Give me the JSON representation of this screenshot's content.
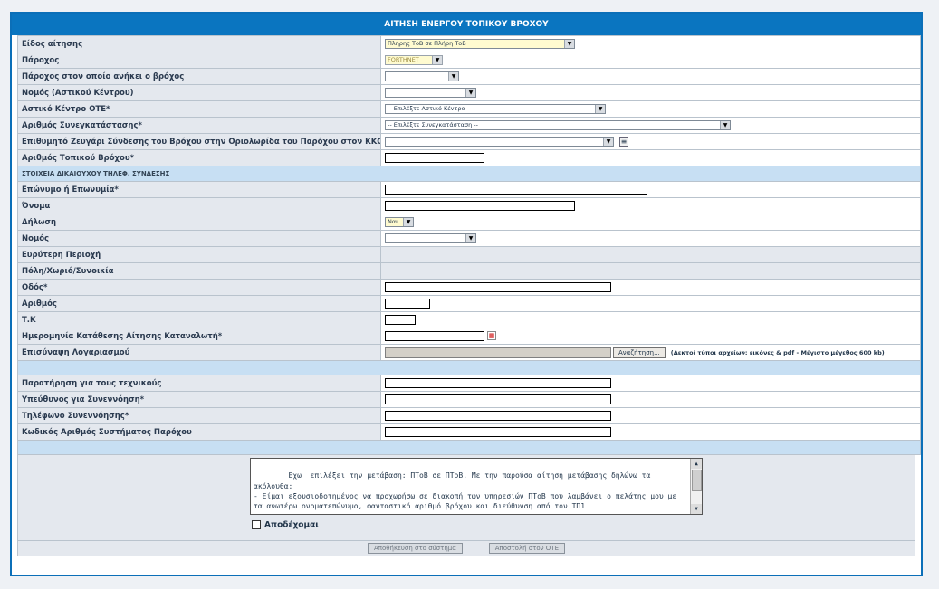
{
  "title": "ΑΙΤΗΣΗ ΕΝΕΡΓΟΥ ΤΟΠΙΚΟΥ ΒΡΟΧΟΥ",
  "fields": {
    "request_type": {
      "label": "Είδος αίτησης",
      "value": "Πλήρης ΤοΒ σε Πλήρη ΤοΒ"
    },
    "provider": {
      "label": "Πάροχος",
      "value": "FORTHNET"
    },
    "loop_provider": {
      "label": "Πάροχος στον οποίο ανήκει ο βρόχος",
      "value": ""
    },
    "prefecture_center": {
      "label": "Νομός (Αστικού Κέντρου)",
      "value": ""
    },
    "ote_center": {
      "label": "Αστικό Κέντρο ΟΤΕ*",
      "value": "-- Επιλέξτε Αστικό Κέντρο --"
    },
    "colocation": {
      "label": "Αριθμός Συνεγκατάστασης*",
      "value": "-- Επιλέξτε Συνεγκατάσταση --"
    },
    "pair": {
      "label": "Επιθυμητό Ζευγάρι Σύνδεσης του Βρόχου στην Οριολωρίδα του Παρόχου στον ΚΚΟ *",
      "value": ""
    },
    "loop_number": {
      "label": "Αριθμός Τοπικού Βρόχου*",
      "value": ""
    }
  },
  "section_subscriber": "ΣΤΟΙΧΕΙΑ ΔΙΚΑΙΟΥΧΟΥ ΤΗΛΕΦ. ΣΥΝΔΕΣΗΣ",
  "subscriber": {
    "surname": {
      "label": "Επώνυμο ή Επωνυμία*",
      "value": ""
    },
    "name": {
      "label": "Όνομα",
      "value": ""
    },
    "declaration": {
      "label": "Δήλωση",
      "value": "Ναι"
    },
    "prefecture": {
      "label": "Νομός",
      "value": ""
    },
    "wider_area": {
      "label": "Ευρύτερη Περιοχή"
    },
    "city": {
      "label": "Πόλη/Χωριό/Συνοικία"
    },
    "street": {
      "label": "Οδός*",
      "value": ""
    },
    "number": {
      "label": "Αριθμός",
      "value": ""
    },
    "zip": {
      "label": "Τ.Κ",
      "value": ""
    },
    "submit_date": {
      "label": "Ημερομηνία Κατάθεσης Αίτησης Καταναλωτή*",
      "value": ""
    },
    "bill": {
      "label": "Επισύναψη Λογαριασμού",
      "browse_label": "Αναζήτηση...",
      "note": "(Δεκτοί τύποι αρχείων: εικόνες & pdf - Μέγιστο μέγεθος 600 kb)"
    }
  },
  "technical": {
    "remarks": {
      "label": "Παρατήρηση για τους τεχνικούς",
      "value": ""
    },
    "contact_person": {
      "label": "Υπεύθυνος για Συνεννόηση*",
      "value": ""
    },
    "contact_phone": {
      "label": "Τηλέφωνο Συνεννόησης*",
      "value": ""
    },
    "provider_code": {
      "label": "Κωδικός Αριθμός Συστήματος Παρόχου",
      "value": ""
    }
  },
  "declaration_text": "Εχω  επιλέξει την μετάβαση: ΠΤοΒ σε ΠΤοΒ. Με την παρούσα αίτηση μετάβασης δηλώνω τα ακόλουθα:\n- Είμαι εξουσιοδοτημένος να προχωρήσω σε διακοπή των υπηρεσιών ΠΤοΒ που λαμβάνει ο πελάτης μου με τα ανωτέρω ονοματεπώνυμο, φανταστικό αριθμό βρόχου και διεύθυνση από τον ΤΠ1",
  "accept_label": "Αποδέχομαι",
  "buttons": {
    "save": "Αποθήκευση στο σύστημα",
    "send": "Αποστολή στον ΟΤΕ"
  },
  "colors": {
    "header": "#0a75c0",
    "section": "#c7dff3",
    "label_bg": "#e4e8ee"
  }
}
